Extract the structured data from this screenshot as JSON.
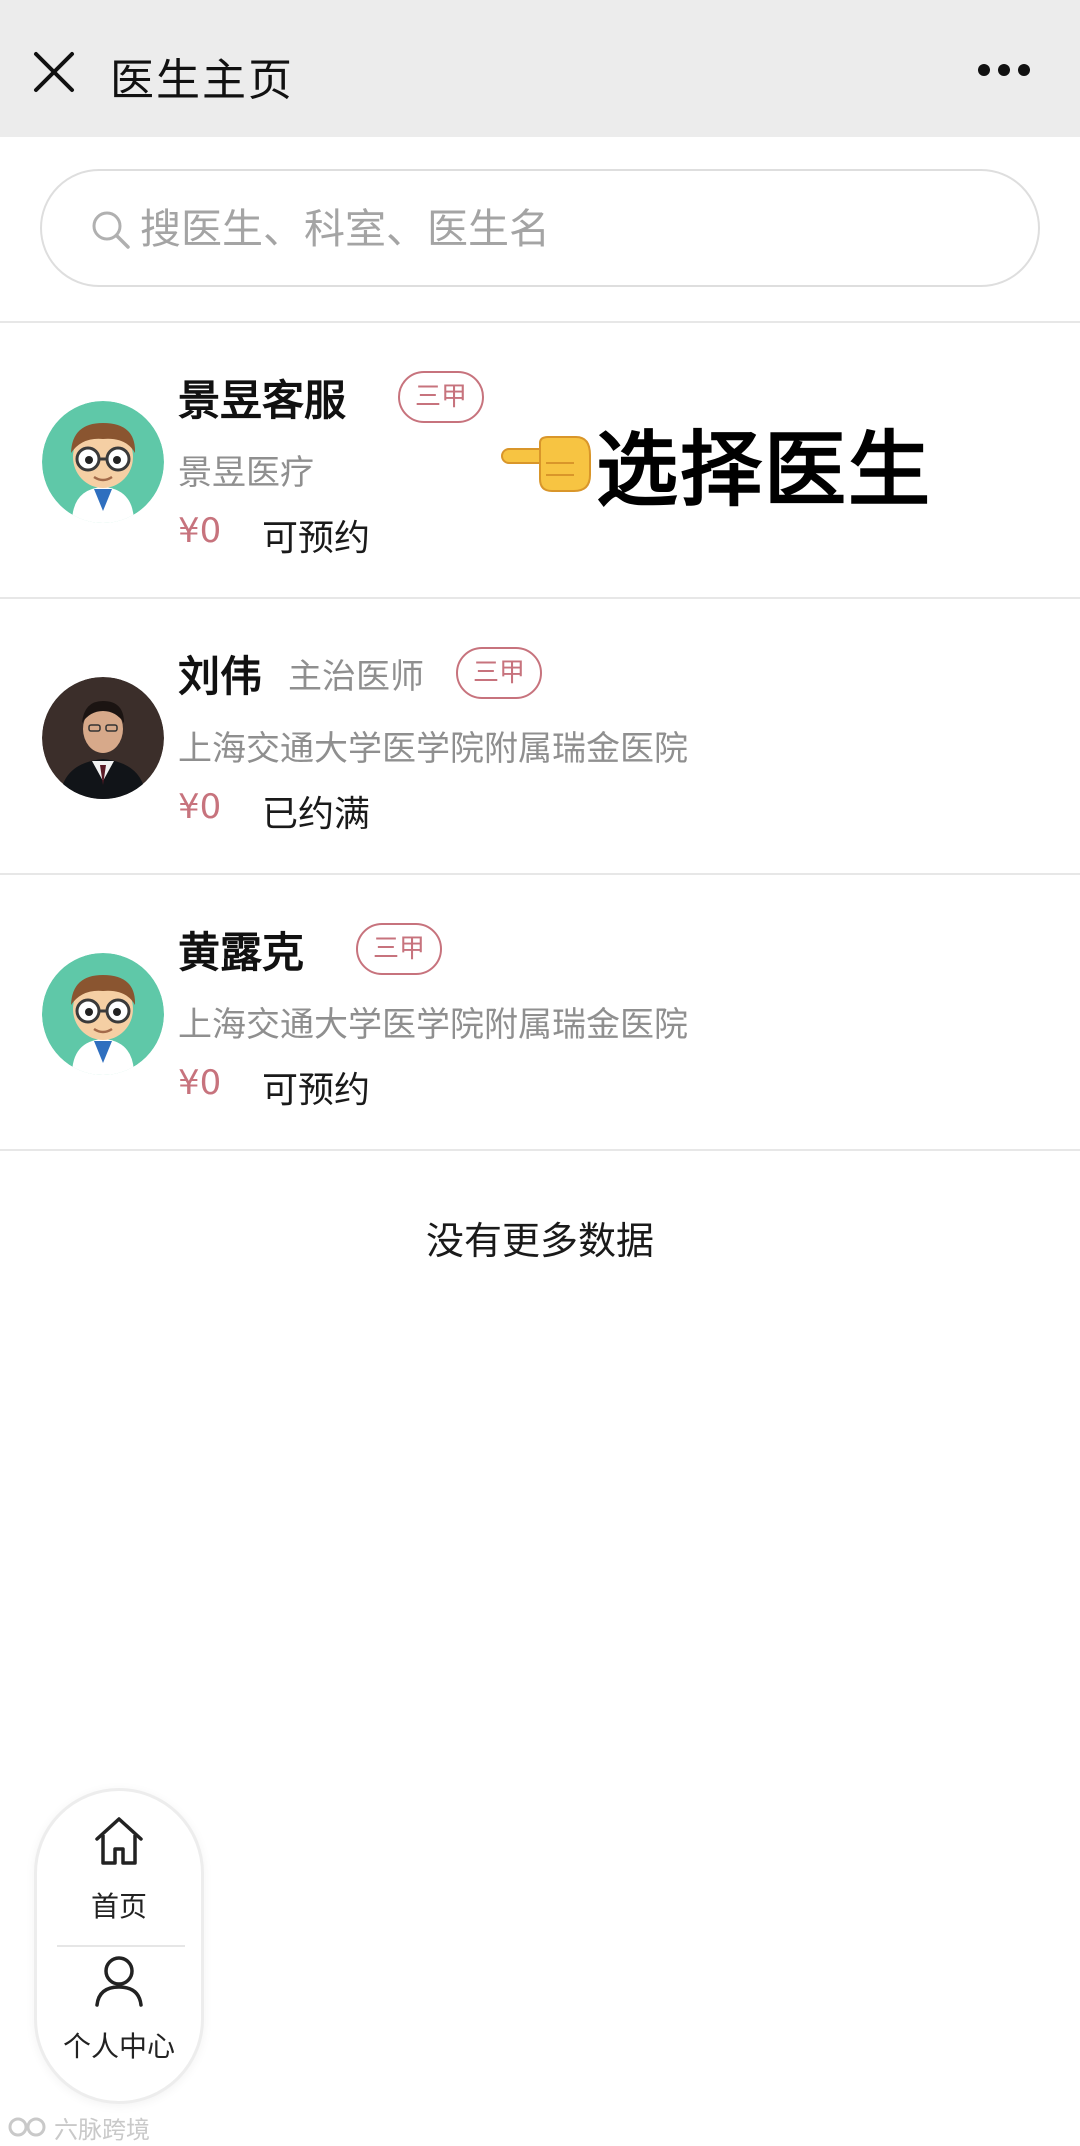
{
  "header": {
    "title": "医生主页"
  },
  "search": {
    "placeholder": "搜医生、科室、医生名",
    "value": ""
  },
  "doctors": [
    {
      "name": "景昱客服",
      "title": "",
      "grade": "三甲",
      "hospital": "景昱医疗",
      "price": "¥0",
      "status": "可预约",
      "avatar": "cartoon-doctor-avatar"
    },
    {
      "name": "刘伟",
      "title": "主治医师",
      "grade": "三甲",
      "hospital": "上海交通大学医学院附属瑞金医院",
      "price": "¥0",
      "status": "已约满",
      "avatar": "photo-avatar"
    },
    {
      "name": "黄露克",
      "title": "",
      "grade": "三甲",
      "hospital": "上海交通大学医学院附属瑞金医院",
      "price": "¥0",
      "status": "可预约",
      "avatar": "cartoon-doctor-avatar"
    }
  ],
  "annotation": {
    "text": "选择医生",
    "icon": "pointing-hand-icon"
  },
  "list_footer": "没有更多数据",
  "nav": {
    "home_label": "首页",
    "profile_label": "个人中心"
  },
  "watermark": {
    "text": "六脉跨境"
  },
  "colors": {
    "accent": "#c7737d",
    "header_bg": "#ececec",
    "muted_text": "#8f8f8f"
  }
}
